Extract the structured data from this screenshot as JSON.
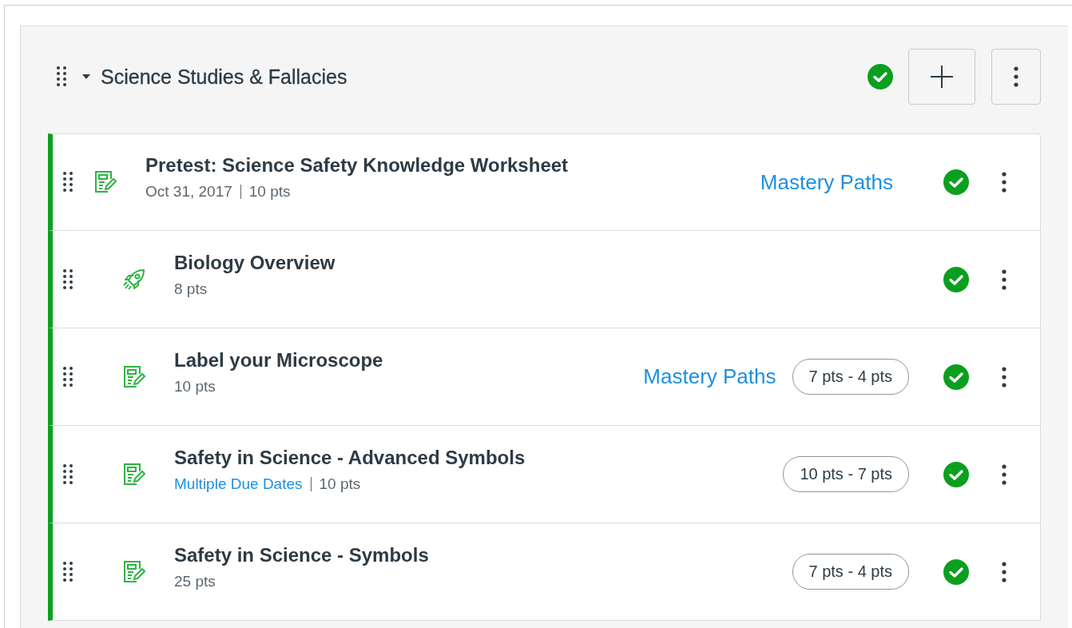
{
  "module": {
    "title": "Science Studies & Fallacies",
    "expanded": true,
    "published": true
  },
  "items": [
    {
      "kind": "assignment",
      "indented": false,
      "title": "Pretest: Science Safety Knowledge Worksheet",
      "meta": [
        {
          "kind": "text",
          "text": "Oct 31, 2017"
        },
        {
          "kind": "text",
          "text": "10 pts"
        }
      ],
      "mastery_link": "Mastery Paths",
      "published": true
    },
    {
      "kind": "quiz",
      "indented": true,
      "title": "Biology Overview",
      "meta": [
        {
          "kind": "text",
          "text": "8 pts"
        }
      ],
      "published": true
    },
    {
      "kind": "assignment",
      "indented": true,
      "title": "Label your Microscope",
      "meta": [
        {
          "kind": "text",
          "text": "10 pts"
        }
      ],
      "mastery_link": "Mastery Paths",
      "range": "7 pts - 4 pts",
      "published": true
    },
    {
      "kind": "assignment",
      "indented": true,
      "title": "Safety in Science - Advanced Symbols",
      "meta": [
        {
          "kind": "link",
          "text": "Multiple Due Dates"
        },
        {
          "kind": "text",
          "text": "10 pts"
        }
      ],
      "range": "10 pts - 7 pts",
      "published": true
    },
    {
      "kind": "assignment",
      "indented": true,
      "title": "Safety in Science - Symbols",
      "meta": [
        {
          "kind": "text",
          "text": "25 pts"
        }
      ],
      "range": "7 pts - 4 pts",
      "published": true
    }
  ]
}
